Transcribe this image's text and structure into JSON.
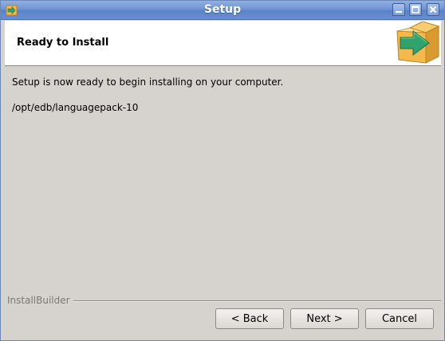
{
  "window": {
    "title": "Setup"
  },
  "header": {
    "title": "Ready to Install"
  },
  "content": {
    "message": "Setup is now ready to begin installing on your computer.",
    "install_path": "/opt/edb/languagepack-10"
  },
  "footer": {
    "brand": "InstallBuilder",
    "back_label": "< Back",
    "next_label": "Next >",
    "cancel_label": "Cancel"
  },
  "icons": {
    "app": "installer-app-icon",
    "minimize": "minimize-icon",
    "maximize": "maximize-icon",
    "close": "close-icon",
    "header": "box-arrow-icon"
  },
  "colors": {
    "titlebar": "#6d93d2",
    "dialog_background": "#d6d2cd",
    "header_background": "#ffffff",
    "logo_box": "#f3b94a",
    "logo_arrow": "#2fa36b"
  }
}
